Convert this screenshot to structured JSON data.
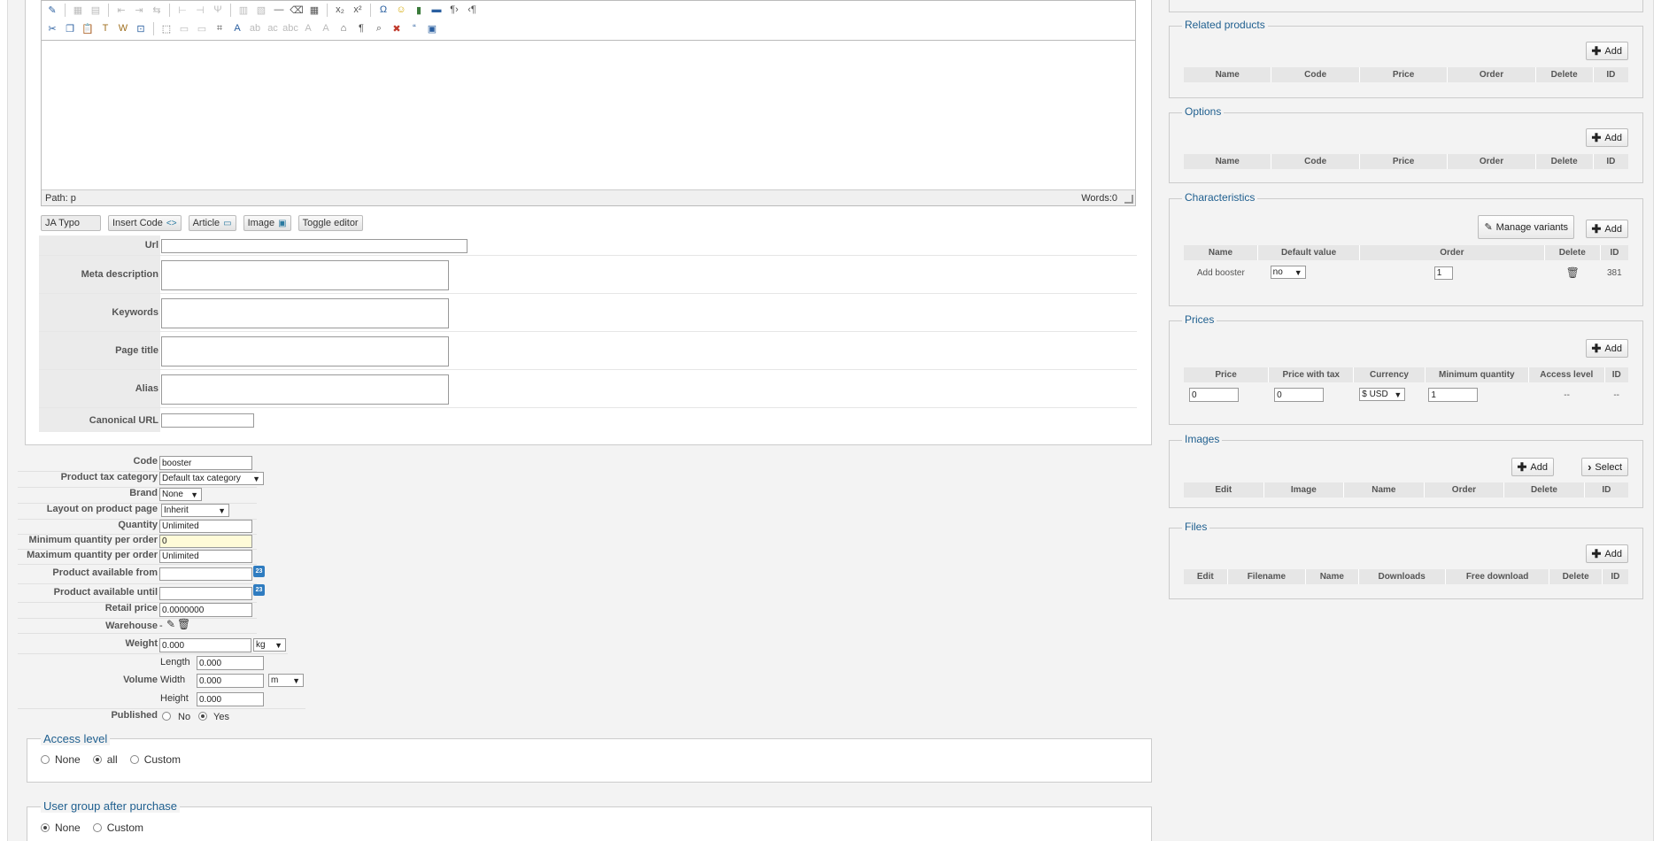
{
  "editor": {
    "path_label": "Path: p",
    "words_label": "Words:0",
    "buttons": [
      {
        "label": "JA Typo"
      },
      {
        "label": "Insert Code"
      },
      {
        "label": "Article"
      },
      {
        "label": "Image"
      },
      {
        "label": "Toggle editor"
      }
    ]
  },
  "meta": {
    "url_label": "Url",
    "meta_description_label": "Meta description",
    "keywords_label": "Keywords",
    "page_title_label": "Page title",
    "alias_label": "Alias",
    "canonical_label": "Canonical URL"
  },
  "product": {
    "code_label": "Code",
    "code_value": "booster",
    "tax_label": "Product tax category",
    "tax_value": "Default tax category",
    "brand_label": "Brand",
    "brand_value": "None",
    "layout_label": "Layout on product page",
    "layout_value": "Inherit",
    "quantity_label": "Quantity",
    "quantity_value": "Unlimited",
    "min_qty_label": "Minimum quantity per order",
    "min_qty_value": "0",
    "max_qty_label": "Maximum quantity per order",
    "max_qty_value": "Unlimited",
    "avail_from_label": "Product available from",
    "avail_until_label": "Product available until",
    "calendar_text": "23",
    "retail_label": "Retail price",
    "retail_value": "0.0000000",
    "warehouse_label": "Warehouse",
    "warehouse_value": "-",
    "weight_label": "Weight",
    "weight_value": "0.000",
    "weight_unit": "kg",
    "volume_label": "Volume",
    "length_label": "Length",
    "length_value": "0.000",
    "width_label": "Width",
    "width_value": "0.000",
    "height_label": "Height",
    "height_value": "0.000",
    "volume_unit": "m",
    "published_label": "Published",
    "published_no": "No",
    "published_yes": "Yes"
  },
  "access_level": {
    "legend": "Access level",
    "none": "None",
    "all": "all",
    "custom": "Custom"
  },
  "user_group": {
    "legend": "User group after purchase",
    "none": "None",
    "custom": "Custom"
  },
  "right": {
    "add_label": "Add",
    "related": {
      "legend": "Related products",
      "columns": [
        "Name",
        "Code",
        "Price",
        "Order",
        "Delete",
        "ID"
      ]
    },
    "options": {
      "legend": "Options",
      "columns": [
        "Name",
        "Code",
        "Price",
        "Order",
        "Delete",
        "ID"
      ]
    },
    "characteristics": {
      "legend": "Characteristics",
      "manage_variants": "Manage variants",
      "columns": [
        "Name",
        "Default value",
        "Order",
        "Delete",
        "ID"
      ],
      "row": {
        "name": "Add booster",
        "default": "no",
        "order": "1",
        "id": "381"
      }
    },
    "prices": {
      "legend": "Prices",
      "columns": [
        "Price",
        "Price with tax",
        "Currency",
        "Minimum quantity",
        "Access level",
        "ID"
      ],
      "row": {
        "price": "0",
        "price_tax": "0",
        "currency": "$ USD",
        "min_qty": "1",
        "access": "--",
        "id": "--"
      }
    },
    "images": {
      "legend": "Images",
      "select_label": "Select",
      "columns": [
        "Edit",
        "Image",
        "Name",
        "Order",
        "Delete",
        "ID"
      ]
    },
    "files": {
      "legend": "Files",
      "columns": [
        "Edit",
        "Filename",
        "Name",
        "Downloads",
        "Free download",
        "Delete",
        "ID"
      ]
    }
  }
}
